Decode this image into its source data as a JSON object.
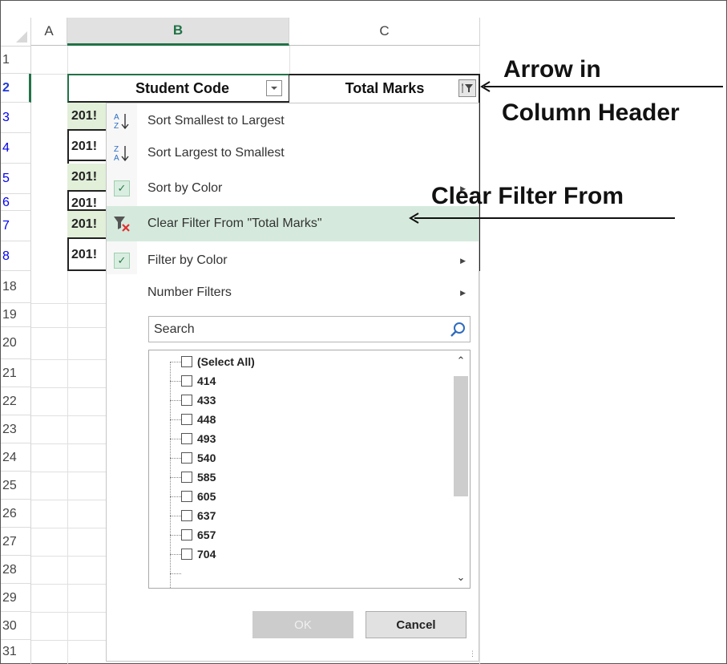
{
  "columns": [
    "A",
    "B",
    "C"
  ],
  "rows": [
    "1",
    "2",
    "3",
    "4",
    "5",
    "6",
    "7",
    "8",
    "18",
    "19",
    "20",
    "21",
    "22",
    "23",
    "24",
    "25",
    "26",
    "27",
    "28",
    "29",
    "30",
    "31"
  ],
  "table": {
    "header_b": "Student Code",
    "header_c": "Total Marks",
    "student_codes": [
      "201!",
      "201!",
      "201!",
      "201!",
      "201!",
      "201!"
    ]
  },
  "menu": {
    "items": [
      {
        "label": "Sort Smallest to Largest",
        "icon": "sort-ascending-icon"
      },
      {
        "label": "Sort Largest to Smallest",
        "icon": "sort-descending-icon"
      },
      {
        "label": "Sort by Color",
        "icon": "check-icon"
      },
      {
        "label": "Clear Filter From \"Total Marks\"",
        "icon": "clear-filter-icon"
      },
      {
        "label": "Filter by Color",
        "icon": "check-icon"
      },
      {
        "label": "Number Filters",
        "icon": ""
      }
    ],
    "search_placeholder": "Search",
    "list": [
      "(Select All)",
      "414",
      "433",
      "448",
      "493",
      "540",
      "585",
      "605",
      "637",
      "657",
      "704"
    ],
    "ok_label": "OK",
    "cancel_label": "Cancel"
  },
  "annotations": {
    "arrow_header_line1": "Arrow in",
    "arrow_header_line2": "Column Header",
    "clear_filter": "Clear Filter From"
  },
  "colors": {
    "excel_green": "#217346",
    "highlight": "#d5eadd",
    "data_fill": "#e2efd9"
  }
}
